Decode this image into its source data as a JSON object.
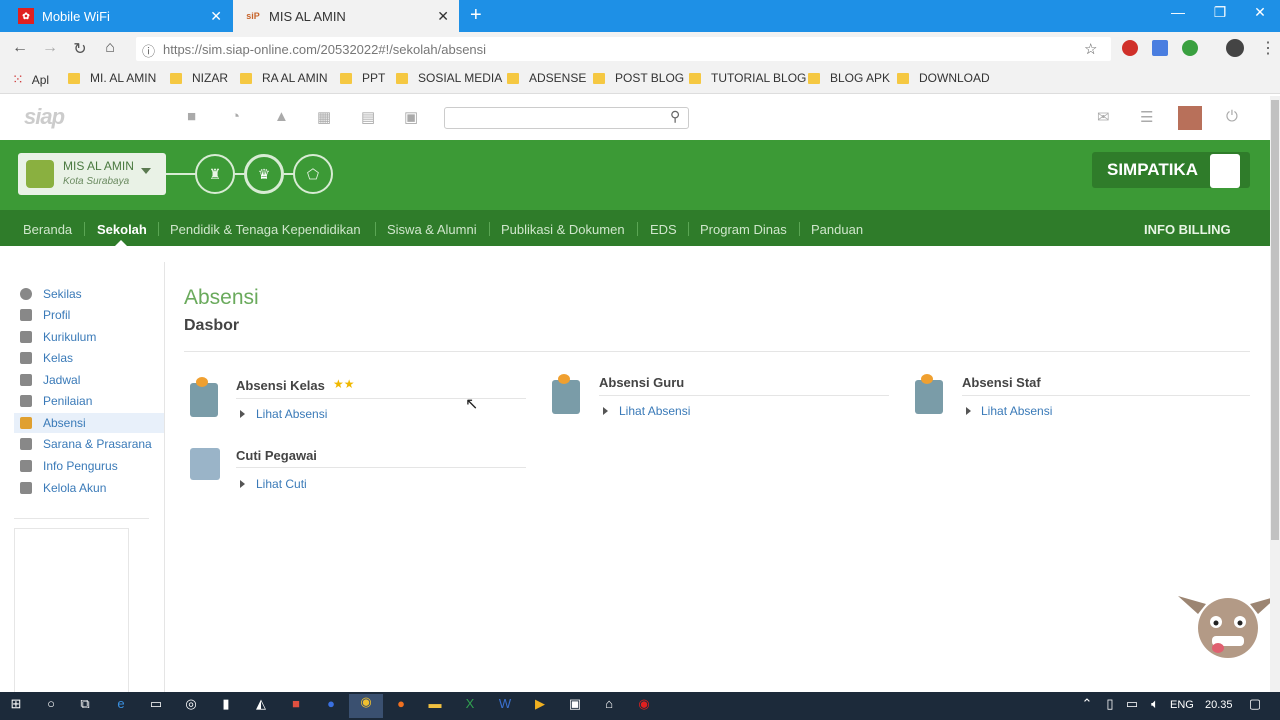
{
  "browser": {
    "tabs": [
      {
        "label": "Mobile WiFi",
        "active": false,
        "favicon": "huawei-icon"
      },
      {
        "label": "MIS AL AMIN",
        "active": true,
        "favicon": "siap-icon"
      }
    ],
    "url_prefix": "https://sim.siap-online.com",
    "url_rest": "/20532022#!/sekolah/absensi",
    "bookmarks": [
      "Apl",
      "MI. AL AMIN",
      "NIZAR",
      "RA AL AMIN",
      "PPT",
      "SOSIAL MEDIA",
      "ADSENSE",
      "POST BLOG",
      "TUTORIAL BLOG",
      "BLOG APK",
      "DOWNLOAD"
    ]
  },
  "site": {
    "logo": "siap",
    "search_placeholder": "",
    "school_name": "MIS AL AMIN",
    "school_city": "Kota Surabaya",
    "brand_button": "SIMPATIKA",
    "nav": [
      "Beranda",
      "Sekolah",
      "Pendidik & Tenaga Kependidikan",
      "Siswa & Alumni",
      "Publikasi & Dokumen",
      "EDS",
      "Program Dinas",
      "Panduan"
    ],
    "nav_active": "Sekolah",
    "billing": "INFO BILLING",
    "colors": {
      "green": "#3c9a36",
      "dark_green": "#2f7c2a",
      "link": "#3a7ab8"
    }
  },
  "sidebar": {
    "items": [
      "Sekilas",
      "Profil",
      "Kurikulum",
      "Kelas",
      "Jadwal",
      "Penilaian",
      "Absensi",
      "Sarana & Prasarana",
      "Info Pengurus",
      "Kelola Akun"
    ],
    "active": "Absensi"
  },
  "main": {
    "title": "Absensi",
    "subtitle": "Dasbor",
    "cards": [
      {
        "title": "Absensi Kelas",
        "link": "Lihat Absensi"
      },
      {
        "title": "Absensi Guru",
        "link": "Lihat Absensi"
      },
      {
        "title": "Absensi Staf",
        "link": "Lihat Absensi"
      },
      {
        "title": "Cuti Pegawai",
        "link": "Lihat Cuti"
      }
    ]
  },
  "taskbar": {
    "lang": "ENG",
    "time": "20.35"
  }
}
